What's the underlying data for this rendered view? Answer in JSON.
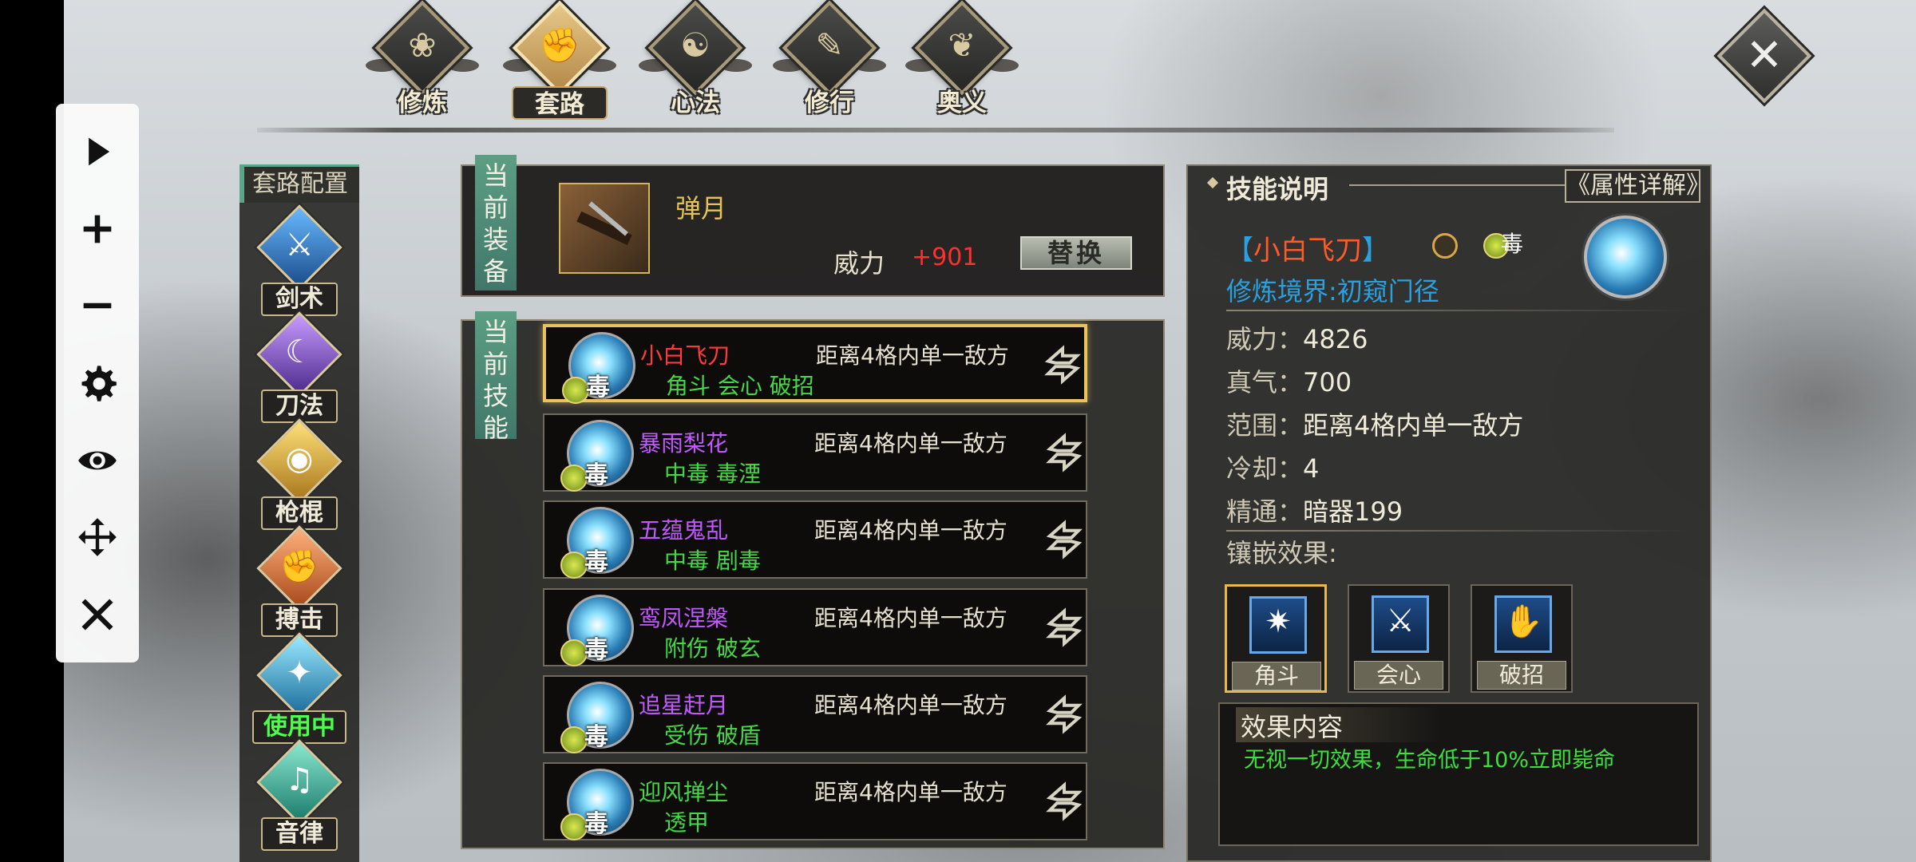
{
  "nav": {
    "tabs": [
      {
        "label": "修炼",
        "icon": "lotus-icon",
        "active": false
      },
      {
        "label": "套路",
        "icon": "fist-icon",
        "active": true
      },
      {
        "label": "心法",
        "icon": "yin-yang-icon",
        "active": false
      },
      {
        "label": "修行",
        "icon": "scroll-icon",
        "active": false
      },
      {
        "label": "奥义",
        "icon": "flame-icon",
        "active": false
      }
    ],
    "close_symbol": "✕"
  },
  "controls": [
    "play-icon",
    "plus-icon",
    "minus-icon",
    "gear-icon",
    "eye-icon",
    "move-icon",
    "close-icon"
  ],
  "categories": {
    "header": "套路配置",
    "items": [
      {
        "label": "剑术",
        "icon": "sword-icon",
        "color": "#3a8ad6"
      },
      {
        "label": "刀法",
        "icon": "blade-icon",
        "color": "#8a5ad6"
      },
      {
        "label": "枪棍",
        "icon": "spear-icon",
        "color": "#d6a83a"
      },
      {
        "label": "搏击",
        "icon": "fist-icon",
        "color": "#d6783a"
      },
      {
        "label": "使用中",
        "icon": "fish-icon",
        "color": "#3aa8d6",
        "active": true
      },
      {
        "label": "音律",
        "icon": "music-icon",
        "color": "#3ab8a8"
      }
    ]
  },
  "equipment": {
    "tag": "当前装备",
    "name": "弹月",
    "power_label": "威力",
    "power_value": "+901",
    "replace_label": "替换"
  },
  "skills": {
    "tag": "当前技能",
    "poison_char": "毒",
    "rows": [
      {
        "name": "小白飞刀",
        "name_color": "#ff3a3a",
        "range": "距离4格内单一敌方",
        "tags": "角斗 会心 破招",
        "selected": true
      },
      {
        "name": "暴雨梨花",
        "name_color": "#c05aff",
        "range": "距离4格内单一敌方",
        "tags": "中毒 毒湮",
        "selected": false
      },
      {
        "name": "五蕴鬼乱",
        "name_color": "#c05aff",
        "range": "距离4格内单一敌方",
        "tags": "中毒 剧毒",
        "selected": false
      },
      {
        "name": "鸾凤涅槃",
        "name_color": "#c05aff",
        "range": "距离4格内单一敌方",
        "tags": "附伤 破玄",
        "selected": false
      },
      {
        "name": "追星赶月",
        "name_color": "#c05aff",
        "range": "距离4格内单一敌方",
        "tags": "受伤 破盾",
        "selected": false
      },
      {
        "name": "迎风掸尘",
        "name_color": "#46d646",
        "range": "距离4格内单一敌方",
        "tags": "透甲",
        "selected": false
      }
    ]
  },
  "info": {
    "title": "技能说明",
    "attr_button": "《属性详解》",
    "skill_bracket_left": "【",
    "skill_name": "小白飞刀",
    "skill_bracket_right": "】",
    "poison_char": "毒",
    "realm": "修炼境界:初窥门径",
    "stats": [
      {
        "label": "威力：",
        "value": "4826"
      },
      {
        "label": "真气：",
        "value": "700"
      },
      {
        "label": "范围：",
        "value": "距离4格内单一敌方"
      },
      {
        "label": "冷却：",
        "value": "4"
      },
      {
        "label": "精通：",
        "value": "暗器199"
      }
    ],
    "inlay_label": "镶嵌效果:",
    "inlays": [
      {
        "label": "角斗",
        "icon": "sword-burst-icon",
        "selected": true
      },
      {
        "label": "会心",
        "icon": "crossed-blades-icon",
        "selected": false
      },
      {
        "label": "破招",
        "icon": "claw-icon",
        "selected": false
      }
    ],
    "effect_title": "效果内容",
    "effect_text": "无视一切效果，生命低于10%立即毙命"
  }
}
